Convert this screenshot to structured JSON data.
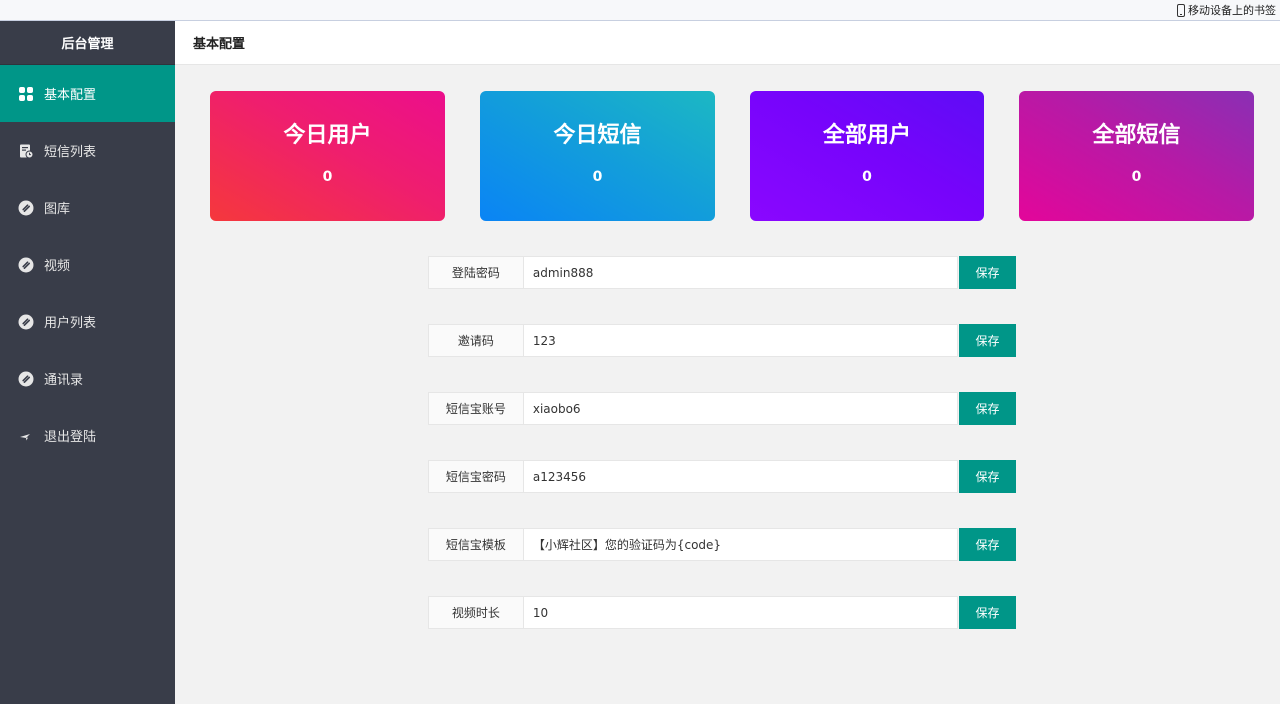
{
  "browser": {
    "bookmark_label": "移动设备上的书签"
  },
  "sidebar": {
    "title": "后台管理",
    "items": [
      {
        "label": "基本配置",
        "icon": "grid-icon",
        "active": true
      },
      {
        "label": "短信列表",
        "icon": "message-list-icon",
        "active": false
      },
      {
        "label": "图库",
        "icon": "link-icon",
        "active": false
      },
      {
        "label": "视频",
        "icon": "link-icon",
        "active": false
      },
      {
        "label": "用户列表",
        "icon": "link-icon",
        "active": false
      },
      {
        "label": "通讯录",
        "icon": "link-icon",
        "active": false
      },
      {
        "label": "退出登陆",
        "icon": "logout-icon",
        "active": false
      }
    ]
  },
  "header": {
    "title": "基本配置"
  },
  "stats": [
    {
      "title": "今日用户",
      "value": "0"
    },
    {
      "title": "今日短信",
      "value": "0"
    },
    {
      "title": "全部用户",
      "value": "0"
    },
    {
      "title": "全部短信",
      "value": "0"
    }
  ],
  "form": {
    "save_label": "保存",
    "rows": [
      {
        "label": "登陆密码",
        "value": "admin888"
      },
      {
        "label": "邀请码",
        "value": "123"
      },
      {
        "label": "短信宝账号",
        "value": "xiaobo6"
      },
      {
        "label": "短信宝密码",
        "value": "a123456"
      },
      {
        "label": "短信宝模板",
        "value": "【小辉社区】您的验证码为{code}"
      },
      {
        "label": "视频时长",
        "value": "10"
      }
    ]
  },
  "colors": {
    "accent": "#009688",
    "sidebar_bg": "#393d49"
  }
}
